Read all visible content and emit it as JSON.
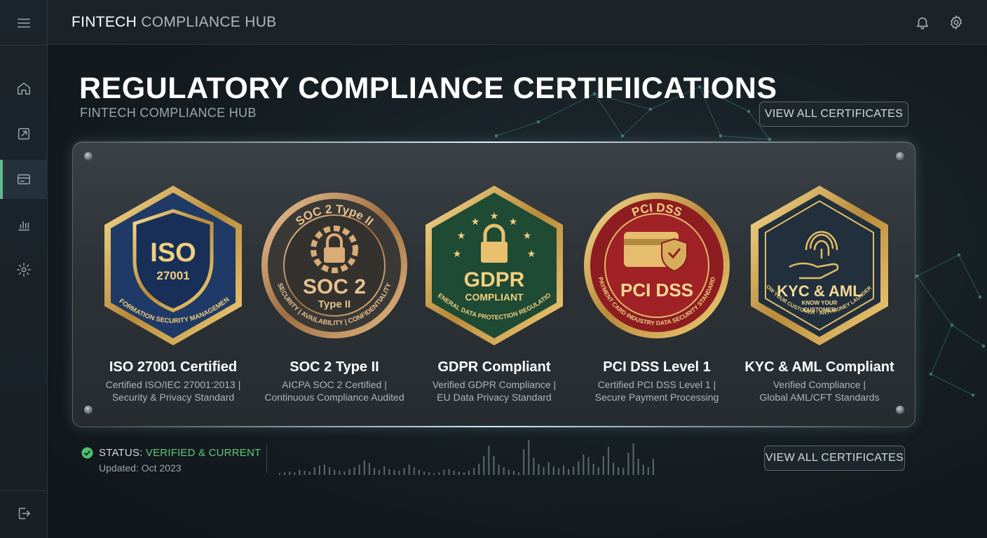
{
  "topbar": {
    "title_part1": "FINTECH",
    "title_part2": "COMPLIANCE HUB",
    "icons": [
      "bell-icon",
      "gear-icon"
    ]
  },
  "sidebar": {
    "items": [
      {
        "icon": "menu-icon"
      },
      {
        "icon": "home-icon"
      },
      {
        "icon": "external-link-icon"
      },
      {
        "icon": "card-icon",
        "active": true
      },
      {
        "icon": "bar-chart-icon"
      },
      {
        "icon": "settings-icon"
      },
      {
        "icon": "logout-icon"
      }
    ]
  },
  "main": {
    "title": "REGULATORY COMPLIANCE CERTIFIICATIONS",
    "subtitle": "FINTECH COMPLIANCE HUB",
    "view_all_label": "VIEW ALL CERTIFICATES"
  },
  "certificates": [
    {
      "name": "ISO 27001 Certified",
      "desc1": "Certified ISO/IEC 27001:2013 |",
      "desc2": "Security & Privacy Standard",
      "badge": {
        "shape": "hexagon",
        "main": "ISO",
        "sub": "27001",
        "ring_text": "INFORMATION SECURITY MANAGEMENT",
        "color": "#1f3a66",
        "trim": "#d9b160"
      }
    },
    {
      "name": "SOC 2 Type II",
      "desc1": "AICPA SOC 2 Certified |",
      "desc2": "Continuous Compliance Audited",
      "badge": {
        "shape": "circle",
        "top": "SOC 2 Type II",
        "main": "SOC 2",
        "sub": "Type II",
        "ring_text": "SECURITY | AVAILABILITY | CONFIDENTIALITY",
        "color": "#3b3a38",
        "trim": "#c8a070"
      }
    },
    {
      "name": "GDPR Compliant",
      "desc1": "Verified GDPR Compliance |",
      "desc2": "EU Data Privacy Standard",
      "badge": {
        "shape": "hexagon",
        "main": "GDPR",
        "sub": "COMPLIANT",
        "ring_text": "GENERAL DATA PROTECTION REGULATION",
        "color": "#1f4a34",
        "trim": "#d9b160"
      }
    },
    {
      "name": "PCI DSS Level 1",
      "desc1": "Certified PCI DSS Level 1 |",
      "desc2": "Secure Payment Processing",
      "badge": {
        "shape": "circle",
        "top": "PCI DSS",
        "main": "PCI DSS",
        "sub": "",
        "ring_text": "PAYMENT CARD INDUSTRY DATA SECURITY STANDARD",
        "color": "#8a1c1f",
        "trim": "#d9b160"
      }
    },
    {
      "name": "KYC & AML Compliant",
      "desc1": "Verified Compliance |",
      "desc2": "Global AML/CFT Standards",
      "badge": {
        "shape": "hexagon",
        "main": "KYC & AML",
        "sub": "KNOW YOUR",
        "sub2": "CUSTOMER",
        "ring_text": "KNOW YOUR CUSTOMER · ANTI-MONEY LAUNDERING",
        "color": "#22303e",
        "trim": "#e2bd63"
      }
    }
  ],
  "status": {
    "label": "STATUS:",
    "value": "VERIFIED & CURRENT",
    "updated": "Updated: Oct 2023",
    "color_ok": "#62c67a"
  },
  "activity_bars": [
    2,
    3,
    4,
    3,
    6,
    5,
    4,
    9,
    11,
    12,
    9,
    6,
    5,
    4,
    7,
    9,
    12,
    17,
    14,
    8,
    6,
    10,
    7,
    6,
    5,
    8,
    12,
    9,
    6,
    4,
    3,
    2,
    3,
    6,
    7,
    5,
    4,
    3,
    5,
    8,
    13,
    22,
    34,
    22,
    12,
    9,
    6,
    5,
    3,
    30,
    41,
    20,
    13,
    9,
    15,
    10,
    8,
    11,
    7,
    10,
    16,
    24,
    21,
    13,
    9,
    22,
    33,
    14,
    9,
    8,
    26,
    37,
    19,
    12,
    9,
    19
  ]
}
